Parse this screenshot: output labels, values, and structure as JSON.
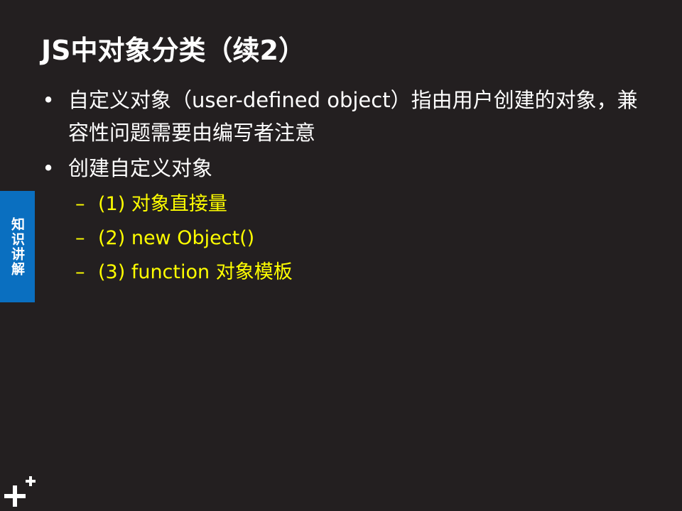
{
  "slide": {
    "title": "JS中对象分类（续2）",
    "side_tab": "知识讲解",
    "bullets": [
      {
        "text": "自定义对象（user-defined object）指由用户创建的对象，兼容性问题需要由编写者注意"
      },
      {
        "text": "创建自定义对象"
      }
    ],
    "sub_items": [
      {
        "text": "(1) 对象直接量"
      },
      {
        "text": "(2) new Object()"
      },
      {
        "text": "(3) function 对象模板"
      }
    ],
    "bullet_glyph": "•",
    "dash_glyph": "–",
    "logo_icon": "plus-logo-icon"
  },
  "colors": {
    "background": "#231f20",
    "text": "#ffffff",
    "highlight": "#ffff00",
    "side_tab": "#0a6fc0"
  }
}
